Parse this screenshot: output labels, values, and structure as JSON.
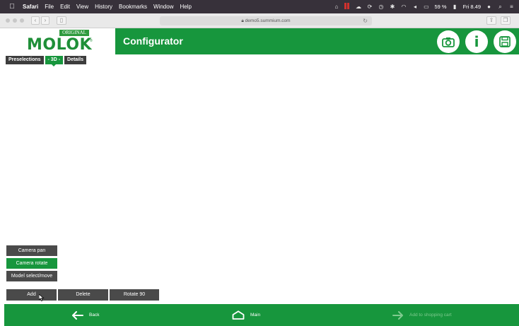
{
  "menubar": {
    "apple": "",
    "app": "Safari",
    "items": [
      "File",
      "Edit",
      "View",
      "History",
      "Bookmarks",
      "Window",
      "Help"
    ],
    "battery": "59 %",
    "clock": "Fri 8.49"
  },
  "browser": {
    "url": "demo5.summium.com",
    "back": "‹",
    "forward": "›"
  },
  "logo": {
    "badge": "ORIGINAL",
    "name": "MOLOK",
    "reg": "®"
  },
  "header": {
    "title": "Configurator",
    "icons": [
      "camera-icon",
      "info-icon",
      "save-icon"
    ],
    "info_glyph": "i"
  },
  "tabs": [
    {
      "label": "Preselections",
      "active": false
    },
    {
      "label": "- 3D -",
      "active": true
    },
    {
      "label": "Details",
      "active": false
    }
  ],
  "camera_modes": [
    {
      "label": "Camera pan",
      "active": false
    },
    {
      "label": "Camera rotate",
      "active": true
    },
    {
      "label": "Model select/move",
      "active": false
    }
  ],
  "actions": {
    "add": "Add",
    "delete": "Delete",
    "rotate": "Rotate 90"
  },
  "footer": {
    "back": "Back",
    "main": "Main",
    "cart": "Add to shopping cart"
  },
  "colors": {
    "brand_green": "#17963d",
    "dark_button": "#4a4a4a",
    "menubar": "#37313a"
  }
}
